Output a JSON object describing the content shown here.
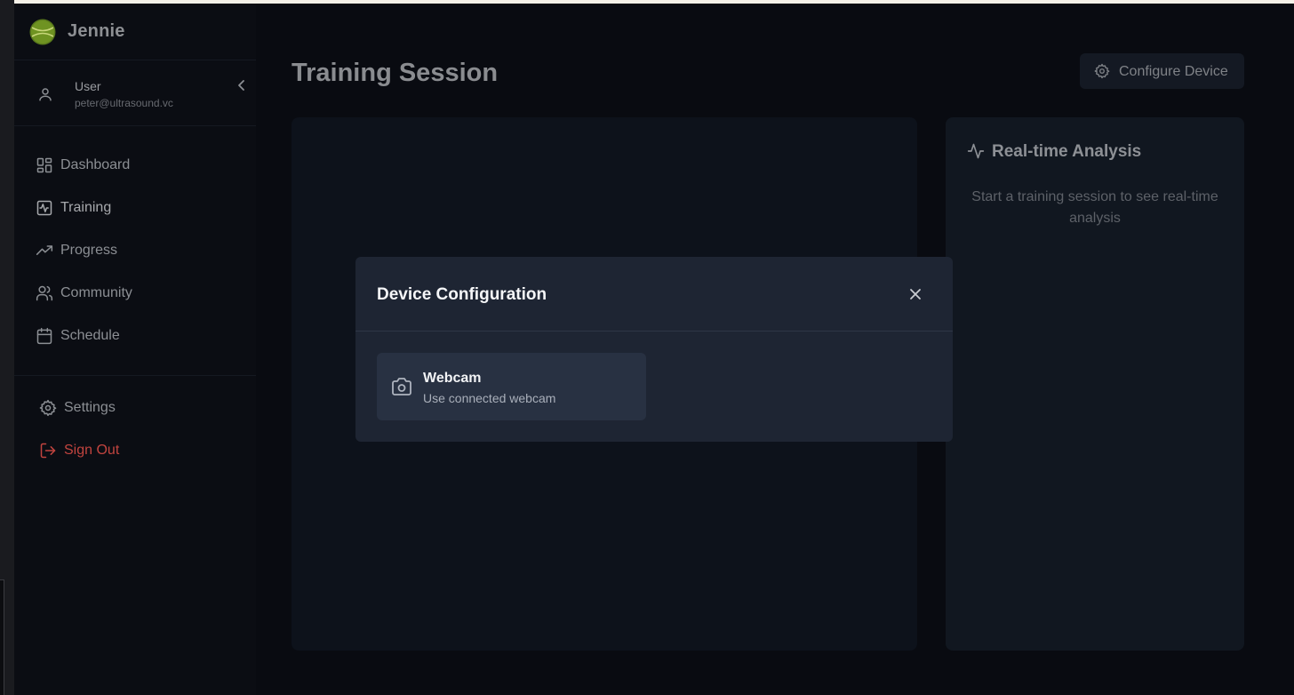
{
  "brand": {
    "name": "Jennie"
  },
  "user": {
    "name": "User",
    "email": "peter@ultrasound.vc"
  },
  "nav": {
    "items": [
      {
        "label": "Dashboard",
        "icon": "dashboard-icon"
      },
      {
        "label": "Training",
        "icon": "activity-icon",
        "active": true
      },
      {
        "label": "Progress",
        "icon": "trending-up-icon"
      },
      {
        "label": "Community",
        "icon": "users-icon"
      },
      {
        "label": "Schedule",
        "icon": "calendar-icon"
      }
    ],
    "settings_label": "Settings",
    "signout_label": "Sign Out"
  },
  "main": {
    "title": "Training Session",
    "configure_label": "Configure Device"
  },
  "analysis": {
    "title": "Real-time Analysis",
    "hint": "Start a training session to see real-time analysis"
  },
  "modal": {
    "title": "Device Configuration",
    "options": [
      {
        "name": "Webcam",
        "description": "Use connected webcam",
        "icon": "camera-icon"
      }
    ]
  },
  "colors": {
    "background": "#090b11",
    "modal": "#1e2533",
    "danger": "#c2443f"
  }
}
